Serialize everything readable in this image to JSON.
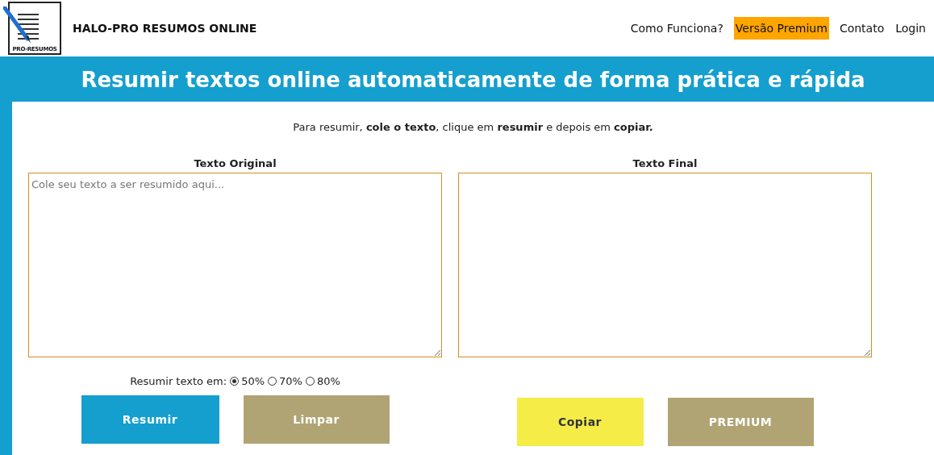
{
  "header": {
    "logo_caption": "PRO-RESUMOS",
    "site_name": "HALO-PRO RESUMOS ONLINE",
    "nav": [
      {
        "label": "Como Funciona?",
        "highlighted": false
      },
      {
        "label": "Versão Premium",
        "highlighted": true
      },
      {
        "label": "Contato",
        "highlighted": false
      },
      {
        "label": "Login",
        "highlighted": false
      }
    ]
  },
  "banner": {
    "title": "Resumir textos online automaticamente de forma prática e rápida"
  },
  "instructions": "Para resumir, **cole o texto**, clique em **resumir** e depois em **copiar.**",
  "original": {
    "label": "Texto Original",
    "placeholder": "Cole seu texto a ser resumido aqui..."
  },
  "final": {
    "label": "Texto Final"
  },
  "ratio": {
    "label": "Resumir texto em:",
    "options": [
      {
        "label": "50%",
        "selected": true
      },
      {
        "label": "70%",
        "selected": false
      },
      {
        "label": "80%",
        "selected": false
      }
    ]
  },
  "left_buttons": [
    {
      "label": "Resumir",
      "kind": "primary"
    },
    {
      "label": "Limpar",
      "kind": "muted"
    }
  ],
  "right_buttons": [
    {
      "label": "Copiar",
      "kind": "accent"
    },
    {
      "label": "PREMIUM",
      "kind": "muted"
    }
  ]
}
